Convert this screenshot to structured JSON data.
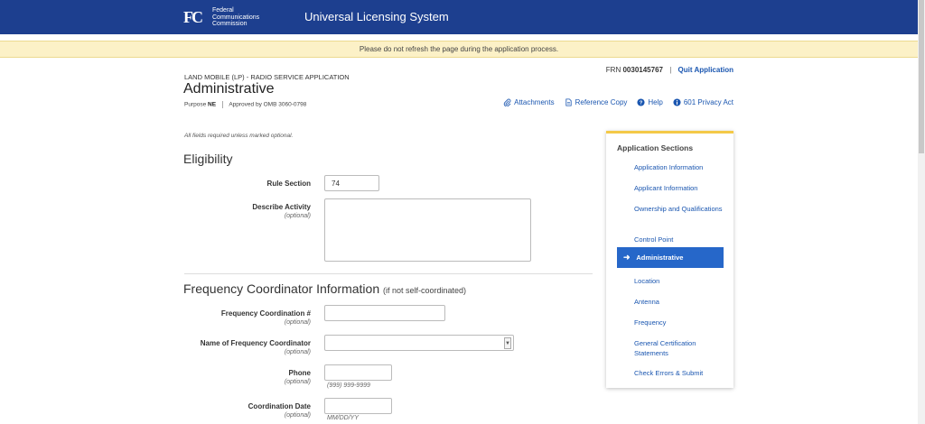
{
  "header": {
    "agency_lines": [
      "Federal",
      "Communications",
      "Commission"
    ],
    "logo_mark": "FC",
    "app_title": "Universal Licensing System"
  },
  "banner": "Please do not refresh the page during the application process.",
  "account": {
    "frn_label": "FRN",
    "frn_value": "0030145767",
    "separator": "|",
    "quit_label": "Quit Application"
  },
  "page": {
    "app_type": "LAND MOBILE (LP) - RADIO SERVICE APPLICATION",
    "title": "Administrative",
    "purpose_label": "Purpose",
    "purpose_value": "NE",
    "approval": "Approved by OMB 3060-0798"
  },
  "toolbar": {
    "attachments": "Attachments",
    "reference_copy": "Reference Copy",
    "help": "Help",
    "privacy": "601 Privacy Act"
  },
  "form": {
    "required_note": "All fields required unless marked optional.",
    "eligibility_heading": "Eligibility",
    "rule_section_label": "Rule Section",
    "rule_section_value": "74",
    "describe_activity_label": "Describe Activity",
    "optional_text": "(optional)",
    "freq_heading": "Frequency Coordinator Information",
    "freq_heading_note": "(if not self-coordinated)",
    "freq_coord_num_label": "Frequency Coordination #",
    "freq_coord_name_label": "Name of Frequency Coordinator",
    "phone_label": "Phone",
    "phone_hint": "(999) 999-9999",
    "coord_date_label": "Coordination Date",
    "coord_date_hint": "MM/DD/YY"
  },
  "sidebar": {
    "title": "Application Sections",
    "items": [
      {
        "label": "Application Information",
        "active": false
      },
      {
        "label": "Applicant Information",
        "active": false
      },
      {
        "label": "Ownership and Qualifications",
        "active": false
      },
      {
        "label": "Control Point",
        "active": false
      },
      {
        "label": "Administrative",
        "active": true
      },
      {
        "label": "Location",
        "active": false
      },
      {
        "label": "Antenna",
        "active": false
      },
      {
        "label": "Frequency",
        "active": false
      },
      {
        "label": "General Certification Statements",
        "active": false
      },
      {
        "label": "Check Errors & Submit",
        "active": false
      }
    ]
  },
  "colors": {
    "header_bg": "#1d3f8f",
    "link": "#1a56b0",
    "active_bg": "#2667c9",
    "banner_bg": "#fcf1c7",
    "sidebar_accent": "#f4c948"
  }
}
